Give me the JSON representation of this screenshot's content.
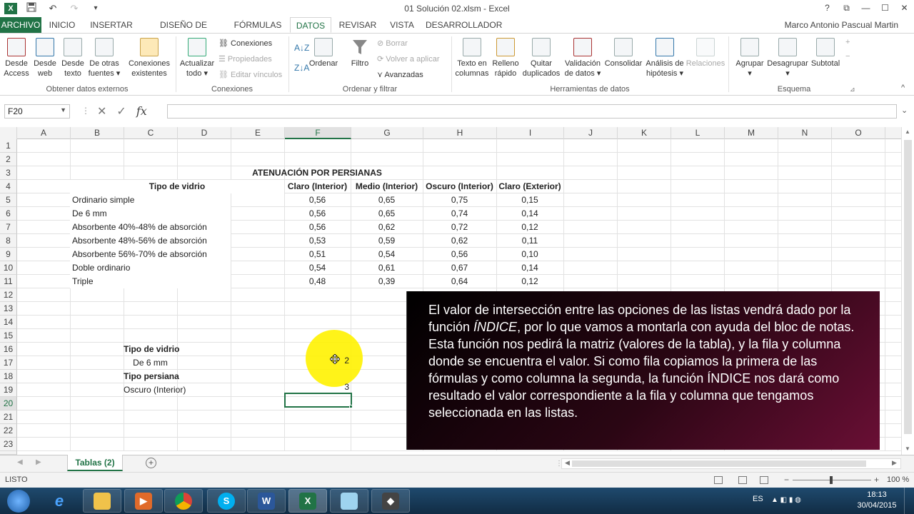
{
  "window": {
    "title": "01 Solución 02.xlsm - Excel",
    "controls": [
      "?",
      "⧉",
      "—",
      "☐",
      "✕"
    ],
    "user": "Marco Antonio Pascual Martin"
  },
  "qat": {
    "save": "save-icon",
    "undo": "↶",
    "redo": "↷"
  },
  "tabs": [
    "ARCHIVO",
    "INICIO",
    "INSERTAR",
    "DISEÑO DE PÁGINA",
    "FÓRMULAS",
    "DATOS",
    "REVISAR",
    "VISTA",
    "DESARROLLADOR"
  ],
  "active_tab": "DATOS",
  "ribbon": {
    "groups": [
      {
        "label": "Obtener datos externos"
      },
      {
        "label": "Conexiones"
      },
      {
        "label": "Ordenar y filtrar"
      },
      {
        "label": "Herramientas de datos"
      },
      {
        "label": "Esquema"
      }
    ],
    "buttons": {
      "access": [
        "Desde",
        "Access"
      ],
      "web": [
        "Desde",
        "web"
      ],
      "texto": [
        "Desde",
        "texto"
      ],
      "otras": [
        "De otras",
        "fuentes ▾"
      ],
      "conex_exist": [
        "Conexiones",
        "existentes"
      ],
      "actualizar": [
        "Actualizar",
        "todo ▾"
      ],
      "ordenar": "Ordenar",
      "filtro": "Filtro",
      "texto_columnas": [
        "Texto en",
        "columnas"
      ],
      "relleno": [
        "Relleno",
        "rápido"
      ],
      "quitar": [
        "Quitar",
        "duplicados"
      ],
      "validacion": [
        "Validación",
        "de datos ▾"
      ],
      "consolidar": "Consolidar",
      "analisis": [
        "Análisis de",
        "hipótesis ▾"
      ],
      "relaciones": "Relaciones",
      "agrupar": [
        "Agrupar",
        "▾"
      ],
      "desagrupar": [
        "Desagrupar",
        "▾"
      ],
      "subtotal": "Subtotal"
    },
    "small": {
      "conexiones": "Conexiones",
      "propiedades": "Propiedades",
      "editar_vinculos": "Editar vínculos",
      "borrar": "Borrar",
      "volver": "Volver a aplicar",
      "avanzadas": "Avanzadas"
    }
  },
  "formula_bar": {
    "name_box": "F20",
    "formula": "",
    "icons": [
      "✕",
      "✓",
      "fx"
    ]
  },
  "columns": [
    "A",
    "B",
    "C",
    "D",
    "E",
    "F",
    "G",
    "H",
    "I",
    "J",
    "K",
    "L",
    "M",
    "N",
    "O"
  ],
  "selected_column": "F",
  "rows": [
    "1",
    "2",
    "3",
    "4",
    "5",
    "6",
    "7",
    "8",
    "9",
    "10",
    "11",
    "12",
    "13",
    "14",
    "15",
    "16",
    "17",
    "18",
    "19",
    "20",
    "21",
    "22",
    "23",
    "24"
  ],
  "selected_row": "20",
  "sheet": {
    "title": "ATENUACIÓN POR PERSIANAS",
    "header_tipo": "Tipo de vidrio",
    "col_headers": [
      "Claro (Interior)",
      "Medio (Interior)",
      "Oscuro (Interior)",
      "Claro (Exterior)"
    ],
    "table": [
      {
        "name": "Ordinario simple",
        "values": [
          "0,56",
          "0,65",
          "0,75",
          "0,15"
        ]
      },
      {
        "name": "De 6 mm",
        "values": [
          "0,56",
          "0,65",
          "0,74",
          "0,14"
        ]
      },
      {
        "name": "Absorbente 40%-48% de absorción",
        "values": [
          "0,56",
          "0,62",
          "0,72",
          "0,12"
        ]
      },
      {
        "name": "Absorbente 48%-56% de absorción",
        "values": [
          "0,53",
          "0,59",
          "0,62",
          "0,11"
        ]
      },
      {
        "name": "Absorbente 56%-70% de absorción",
        "values": [
          "0,51",
          "0,54",
          "0,56",
          "0,10"
        ]
      },
      {
        "name": "Doble ordinario",
        "values": [
          "0,54",
          "0,61",
          "0,67",
          "0,14"
        ]
      },
      {
        "name": "Triple",
        "values": [
          "0,48",
          "0,39",
          "0,64",
          "0,12"
        ]
      }
    ],
    "sel_tipo_label": "Tipo de vidrio",
    "sel_tipo_value": "De 6 mm",
    "sel_persiana_label": "Tipo persiana",
    "sel_persiana_value": "Oscuro (Interior)",
    "f17": "2",
    "f19": "3"
  },
  "note": {
    "p1": "El valor de intersección entre las opciones de las listas vendrá dado por la función ",
    "em": "ÍNDICE",
    "p2": ", por lo que vamos a montarla con ayuda del bloc de notas. Esta función nos pedirá la matriz (valores de la tabla), y la fila y columna donde se encuentra el valor. Si como fila copiamos la primera de las fórmulas y como columna la segunda, la función ÍNDICE nos dará como resultado el valor correspondiente a la fila y columna que tengamos seleccionada en las listas."
  },
  "sheet_tabs": {
    "active": "Tablas (2)",
    "add": "+"
  },
  "status": {
    "mode": "LISTO",
    "zoom": "100 %",
    "zoom_minus": "−",
    "zoom_plus": "+"
  },
  "taskbar": {
    "apps": [
      "start-orb",
      "ie-icon",
      "explorer-icon",
      "media-icon",
      "chrome-icon",
      "skype-icon",
      "word-icon",
      "excel-icon",
      "notepad-icon",
      "app-icon"
    ],
    "lang": "ES",
    "time": "18:13",
    "date": "30/04/2015"
  },
  "colors": {
    "excel_green": "#217346",
    "highlight": "#fff200",
    "note_bg": "#2b0614"
  }
}
